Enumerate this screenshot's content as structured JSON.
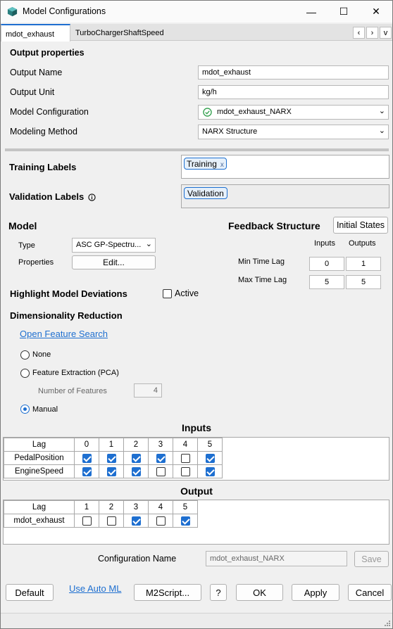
{
  "window": {
    "title": "Model Configurations",
    "minimize": "—",
    "maximize": "☐",
    "close": "✕"
  },
  "tabs": [
    {
      "label": "mdot_exhaust",
      "active": true
    },
    {
      "label": "TurboChargerShaftSpeed",
      "active": false
    }
  ],
  "tab_nav": {
    "prev": "‹",
    "next": "›",
    "menu": "v"
  },
  "output": {
    "section_title": "Output properties",
    "name_label": "Output Name",
    "name_value": "mdot_exhaust",
    "unit_label": "Output Unit",
    "unit_value": "kg/h",
    "config_label": "Model Configuration",
    "config_value": "mdot_exhaust_NARX",
    "method_label": "Modeling Method",
    "method_value": "NARX Structure"
  },
  "labels": {
    "training_title": "Training Labels",
    "training_chip": "Training",
    "chip_remove": "x",
    "validation_title": "Validation Labels",
    "validation_chip": "Validation"
  },
  "model": {
    "title": "Model",
    "type_label": "Type",
    "type_value": "ASC GP-Spectru...",
    "properties_label": "Properties",
    "edit_button": "Edit..."
  },
  "feedback": {
    "title": "Feedback Structure",
    "initial_states_button": "Initial States",
    "inputs_header": "Inputs",
    "outputs_header": "Outputs",
    "min_label": "Min Time Lag",
    "max_label": "Max Time Lag",
    "min_inputs": "0",
    "min_outputs": "1",
    "max_inputs": "5",
    "max_outputs": "5"
  },
  "highlight": {
    "title": "Highlight Model Deviations",
    "active_label": "Active",
    "active_checked": false
  },
  "dimred": {
    "title": "Dimensionality Reduction",
    "link": "Open Feature Search",
    "none_label": "None",
    "pca_label": "Feature Extraction (PCA)",
    "num_features_label": "Number of Features",
    "num_features_value": "4",
    "manual_label": "Manual",
    "selected": "Manual"
  },
  "inputs_grid": {
    "title": "Inputs",
    "header_label": "Lag",
    "lags": [
      "0",
      "1",
      "2",
      "3",
      "4",
      "5"
    ],
    "rows": [
      {
        "name": "PedalPosition",
        "checks": [
          true,
          true,
          true,
          true,
          false,
          true
        ]
      },
      {
        "name": "EngineSpeed",
        "checks": [
          true,
          true,
          true,
          false,
          false,
          true
        ]
      }
    ]
  },
  "output_grid": {
    "title": "Output",
    "header_label": "Lag",
    "lags": [
      "1",
      "2",
      "3",
      "4",
      "5"
    ],
    "rows": [
      {
        "name": "mdot_exhaust",
        "checks": [
          false,
          false,
          true,
          false,
          true
        ]
      }
    ]
  },
  "config_name": {
    "label": "Configuration Name",
    "value": "mdot_exhaust_NARX",
    "save_button": "Save"
  },
  "footer": {
    "default_button": "Default",
    "automl_link": "Use Auto ML",
    "m2script_button": "M2Script...",
    "help_button": "?",
    "ok_button": "OK",
    "apply_button": "Apply",
    "cancel_button": "Cancel"
  },
  "colors": {
    "accent": "#1e6fd0",
    "window_bg": "#f0f0f0",
    "separator": "#c4c4c4",
    "success": "#2e9e4a"
  }
}
